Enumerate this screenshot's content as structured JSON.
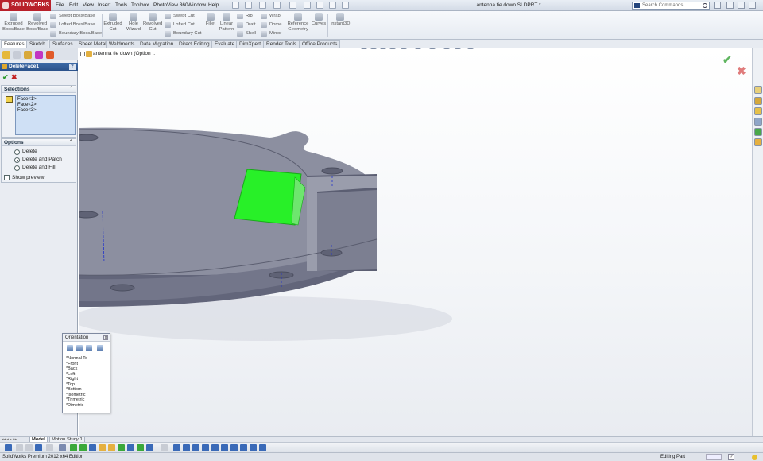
{
  "app": {
    "logo": "SOLIDWORKS",
    "menus": [
      "File",
      "Edit",
      "View",
      "Insert",
      "Tools",
      "Toolbox",
      "PhotoView 360",
      "Window",
      "Help"
    ],
    "document_title": "antenna tie down.SLDPRT *",
    "search_placeholder": "Search Commands"
  },
  "command_manager": {
    "extruded_boss": "Extruded Boss/Base",
    "revolved_boss": "Revolved Boss/Base",
    "swept_boss": "Swept Boss/Base",
    "lofted_boss": "Lofted Boss/Base",
    "boundary_boss": "Boundary Boss/Base",
    "extruded_cut": "Extruded Cut",
    "hole_wizard": "Hole Wizard",
    "revolved_cut": "Revolved Cut",
    "swept_cut": "Swept Cut",
    "lofted_cut": "Lofted Cut",
    "boundary_cut": "Boundary Cut",
    "fillet": "Fillet",
    "linear_pattern": "Linear Pattern",
    "rib": "Rib",
    "draft": "Draft",
    "shell": "Shell",
    "wrap": "Wrap",
    "dome": "Dome",
    "mirror": "Mirror",
    "reference_geometry": "Reference Geometry",
    "curves": "Curves",
    "instant3d": "Instant3D"
  },
  "tabs": [
    "Features",
    "Sketch",
    "Surfaces",
    "Sheet Metal",
    "Weldments",
    "Data Migration",
    "Direct Editing",
    "Evaluate",
    "DimXpert",
    "Render Tools",
    "Office Products"
  ],
  "property_manager": {
    "title": "DeleteFace1",
    "help": "?",
    "selections_header": "Selections",
    "selections": [
      "Face<1>",
      "Face<2>",
      "Face<3>"
    ],
    "options_header": "Options",
    "options": [
      "Delete",
      "Delete and Patch",
      "Delete and Fill"
    ],
    "selected_option": "Delete and Patch",
    "show_preview": "Show preview"
  },
  "viewport": {
    "tree_label": "antenna tie down  (Option ..",
    "part_colors": {
      "body_top": "#8a8d9c",
      "body_side": "#62657a",
      "selected_face": "#28f028"
    }
  },
  "orientation": {
    "title": "Orientation",
    "close": "x",
    "views": [
      "*Normal To",
      "*Front",
      "*Back",
      "*Left",
      "*Right",
      "*Top",
      "*Bottom",
      "*Isometric",
      "*Trimetric",
      "*Dimetric"
    ]
  },
  "bottom_tabs": [
    "Model",
    "Motion Study 1"
  ],
  "status": {
    "left": "SolidWorks Premium 2012 x64 Edition",
    "right": "Editing Part",
    "help": "?"
  }
}
